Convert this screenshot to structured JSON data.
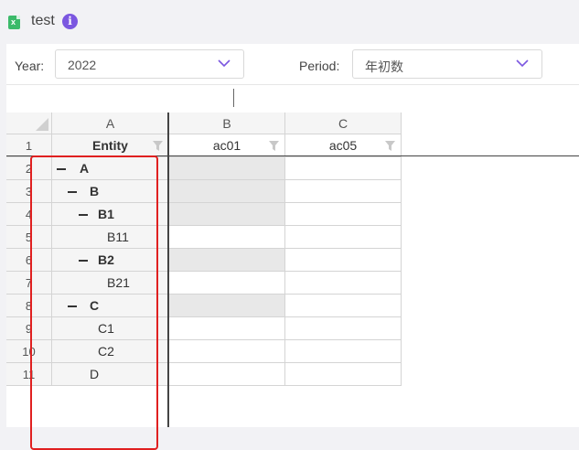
{
  "window": {
    "title": "test",
    "doc_icon": "spreadsheet-icon",
    "info_icon": "info-icon"
  },
  "filters": {
    "year": {
      "label": "Year:",
      "value": "2022"
    },
    "period": {
      "label": "Period:",
      "value": "年初数"
    }
  },
  "sheet": {
    "columns": [
      "A",
      "B",
      "C"
    ],
    "header_row": [
      "Entity",
      "ac01",
      "ac05"
    ],
    "rows": [
      {
        "num": "1"
      },
      {
        "num": "2",
        "label": "A",
        "level": 0,
        "collapsible": true,
        "bold": true,
        "b_shaded": true
      },
      {
        "num": "3",
        "label": "B",
        "level": 1,
        "collapsible": true,
        "bold": true,
        "b_shaded": true
      },
      {
        "num": "4",
        "label": "B1",
        "level": 2,
        "collapsible": true,
        "bold": true,
        "b_shaded": true
      },
      {
        "num": "5",
        "label": "B11",
        "level": 3,
        "collapsible": false,
        "bold": false,
        "b_shaded": false
      },
      {
        "num": "6",
        "label": "B2",
        "level": 2,
        "collapsible": true,
        "bold": true,
        "b_shaded": true
      },
      {
        "num": "7",
        "label": "B21",
        "level": 3,
        "collapsible": false,
        "bold": false,
        "b_shaded": false
      },
      {
        "num": "8",
        "label": "C",
        "level": 1,
        "collapsible": true,
        "bold": true,
        "b_shaded": true
      },
      {
        "num": "9",
        "label": "C1",
        "level": 2,
        "collapsible": false,
        "bold": false,
        "b_shaded": false
      },
      {
        "num": "10",
        "label": "C2",
        "level": 2,
        "collapsible": false,
        "bold": false,
        "b_shaded": false
      },
      {
        "num": "11",
        "label": "D",
        "level": 1,
        "collapsible": false,
        "bold": false,
        "b_shaded": false
      }
    ]
  },
  "colors": {
    "accent": "#7b57e0",
    "highlight_box": "#e02020",
    "shaded_cell": "#e8e8e8"
  }
}
